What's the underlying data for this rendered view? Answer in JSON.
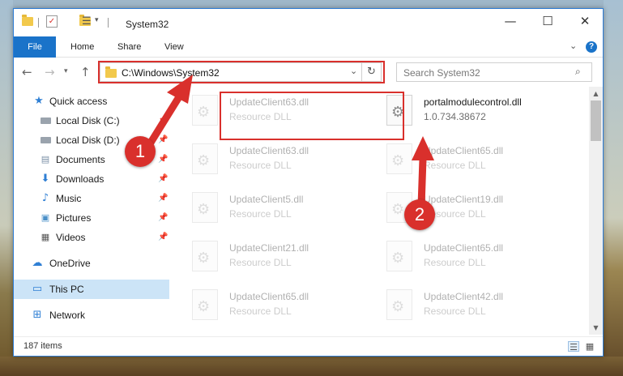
{
  "window": {
    "title": "System32",
    "ribbon_tabs": [
      "File",
      "Home",
      "Share",
      "View"
    ],
    "controls": {
      "minimize": "—",
      "maximize": "☐",
      "close": "✕"
    }
  },
  "address_bar": {
    "path": "C:\\Windows\\System32",
    "refresh_icon": "refresh-icon"
  },
  "search": {
    "placeholder": "Search System32"
  },
  "sidebar": {
    "items": [
      {
        "label": "Quick access",
        "icon": "star-icon",
        "pinned": false
      },
      {
        "label": "Local Disk (C:)",
        "icon": "drive-icon",
        "pinned": true
      },
      {
        "label": "Local Disk (D:)",
        "icon": "drive-icon",
        "pinned": true
      },
      {
        "label": "Documents",
        "icon": "documents-icon",
        "pinned": true
      },
      {
        "label": "Downloads",
        "icon": "download-icon",
        "pinned": true
      },
      {
        "label": "Music",
        "icon": "music-icon",
        "pinned": true
      },
      {
        "label": "Pictures",
        "icon": "pictures-icon",
        "pinned": true
      },
      {
        "label": "Videos",
        "icon": "videos-icon",
        "pinned": true
      },
      {
        "label": "OneDrive",
        "icon": "cloud-icon",
        "pinned": false
      },
      {
        "label": "This PC",
        "icon": "computer-icon",
        "pinned": false,
        "selected": true
      },
      {
        "label": "Network",
        "icon": "network-icon",
        "pinned": false
      }
    ]
  },
  "files": [
    {
      "name": "UpdateClient63.dll",
      "type": "Resource DLL",
      "faded": true
    },
    {
      "name": "portalmodulecontrol.dll",
      "type": "1.0.734.38672",
      "faded": false
    },
    {
      "name": "UpdateClient63.dll",
      "type": "Resource DLL",
      "faded": true
    },
    {
      "name": "UpdateClient65.dll",
      "type": "Resource DLL",
      "faded": true
    },
    {
      "name": "UpdateClient5.dll",
      "type": "Resource DLL",
      "faded": true
    },
    {
      "name": "UpdateClient19.dll",
      "type": "Resource DLL",
      "faded": true
    },
    {
      "name": "UpdateClient21.dll",
      "type": "Resource DLL",
      "faded": true
    },
    {
      "name": "UpdateClient65.dll",
      "type": "Resource DLL",
      "faded": true
    },
    {
      "name": "UpdateClient65.dll",
      "type": "Resource DLL",
      "faded": true
    },
    {
      "name": "UpdateClient42.dll",
      "type": "Resource DLL",
      "faded": true
    }
  ],
  "status": {
    "item_count": "187 items"
  },
  "annotations": [
    {
      "number": "1",
      "target": "address-bar"
    },
    {
      "number": "2",
      "target": "portalmodulecontrol.dll"
    }
  ],
  "colors": {
    "accent": "#1a73c9",
    "annotation_red": "#d9302c",
    "selected_nav": "#cce4f7"
  }
}
